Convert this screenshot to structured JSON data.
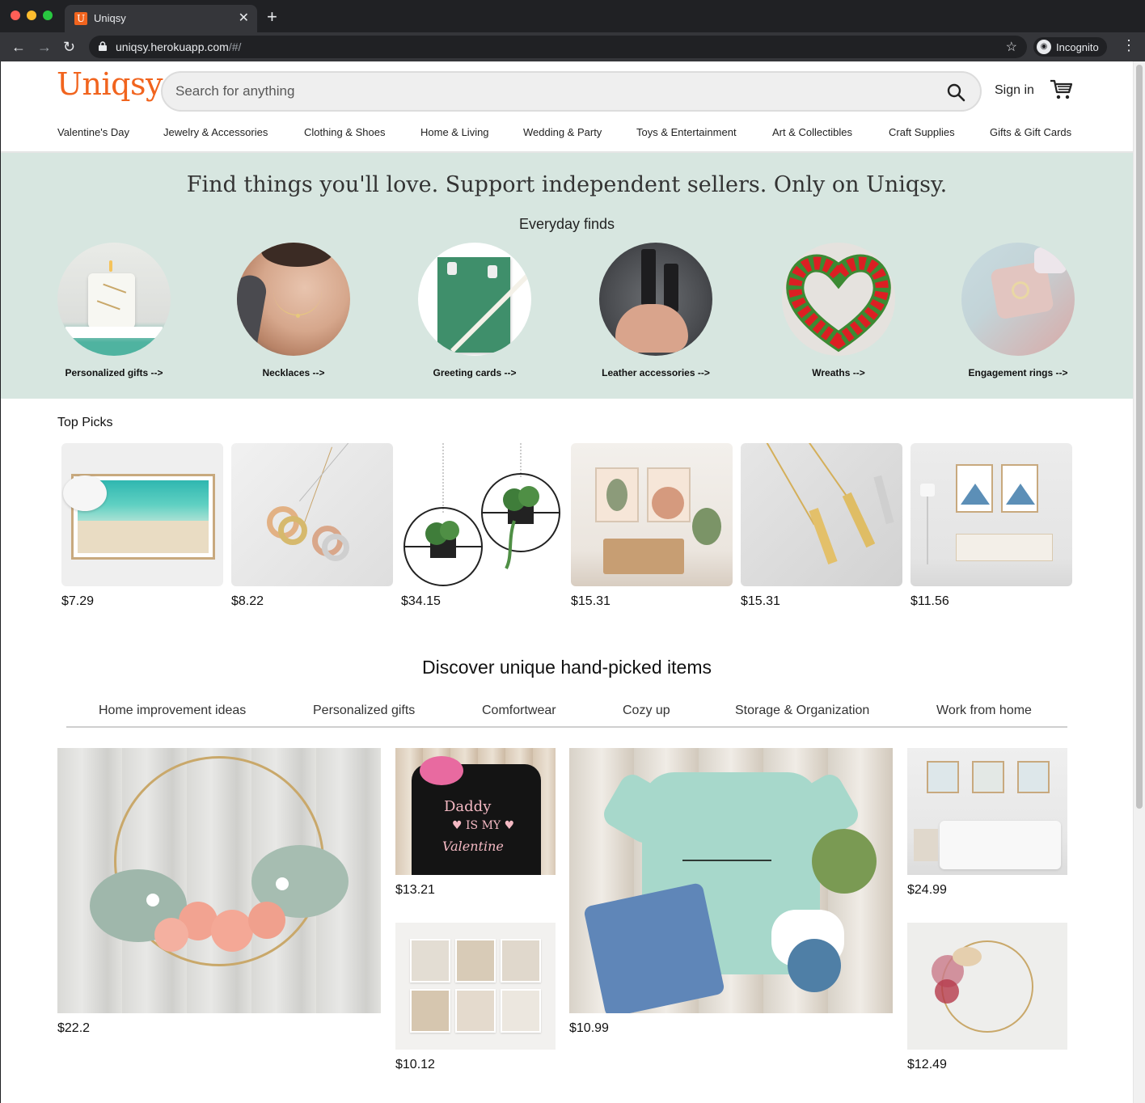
{
  "browser": {
    "tab_title": "Uniqsy",
    "favicon_letter": "U",
    "url_host": "uniqsy.herokuapp.com",
    "url_path": "/#/",
    "incognito_label": "Incognito"
  },
  "header": {
    "logo": "Uniqsy",
    "search_placeholder": "Search for anything",
    "signin_label": "Sign in"
  },
  "categories": [
    "Valentine's Day",
    "Jewelry & Accessories",
    "Clothing & Shoes",
    "Home & Living",
    "Wedding & Party",
    "Toys & Entertainment",
    "Art & Collectibles",
    "Craft Supplies",
    "Gifts & Gift Cards"
  ],
  "hero": {
    "title": "Find things you'll love. Support independent sellers. Only on Uniqsy.",
    "subtitle": "Everyday finds",
    "items": [
      {
        "label": "Personalized gifts -->"
      },
      {
        "label": "Necklaces -->"
      },
      {
        "label": "Greeting cards -->"
      },
      {
        "label": "Leather accessories -->"
      },
      {
        "label": "Wreaths -->"
      },
      {
        "label": "Engagement rings -->"
      }
    ]
  },
  "top_picks": {
    "title": "Top Picks",
    "items": [
      {
        "price": "$7.29"
      },
      {
        "price": "$8.22"
      },
      {
        "price": "$34.15"
      },
      {
        "price": "$15.31"
      },
      {
        "price": "$15.31"
      },
      {
        "price": "$11.56"
      }
    ]
  },
  "discover": {
    "title": "Discover unique hand-picked items",
    "tabs": [
      "Home improvement ideas",
      "Personalized gifts",
      "Comfortwear",
      "Cozy up",
      "Storage & Organization",
      "Work from home"
    ],
    "items": [
      {
        "price": "$22.2"
      },
      {
        "price": "$13.21"
      },
      {
        "price": "$10.12"
      },
      {
        "price": "$10.99"
      },
      {
        "price": "$24.99"
      },
      {
        "price": "$12.49"
      }
    ]
  },
  "colors": {
    "brand": "#f1641e",
    "hero_bg": "#d7e6e0"
  }
}
